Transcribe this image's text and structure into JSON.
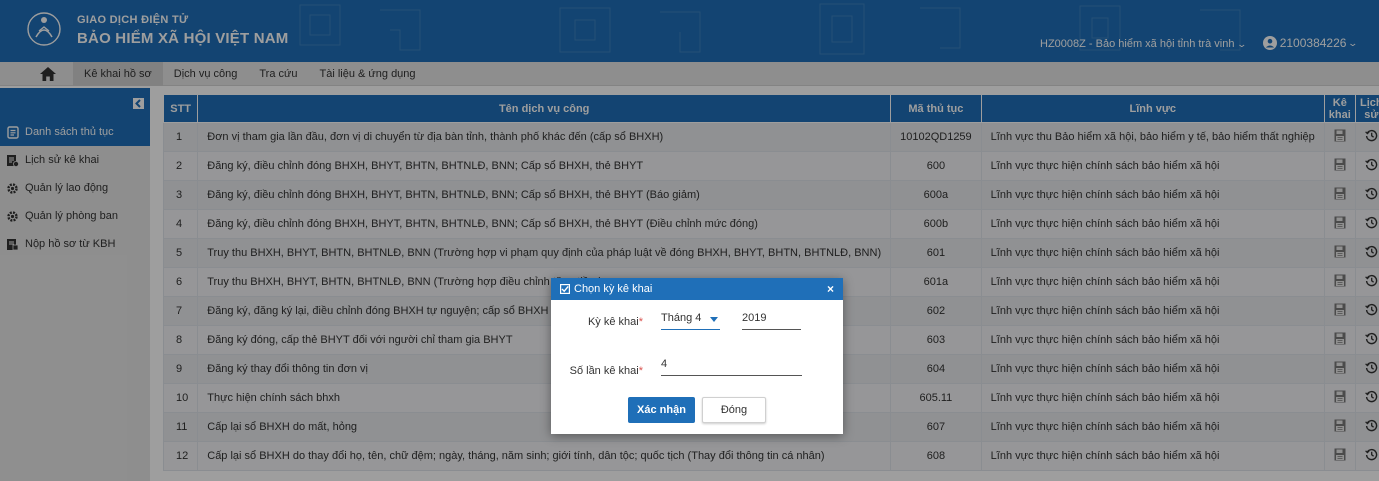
{
  "header": {
    "brand_sub": "GIAO DỊCH ĐIỆN TỬ",
    "brand_main": "BẢO HIỂM XÃ HỘI VIỆT NAM",
    "org": "HZ0008Z - Bảo hiểm xã hội tỉnh trà vinh",
    "user": "2100384226",
    "color": "#1f6fb8"
  },
  "nav": {
    "items": [
      "Kê khai hồ sơ",
      "Dịch vụ công",
      "Tra cứu",
      "Tài liệu & ứng dụng"
    ]
  },
  "sidebar": {
    "items": [
      {
        "label": "Danh sách thủ tục",
        "icon": "document-list-icon"
      },
      {
        "label": "Lịch sử kê khai",
        "icon": "history-doc-icon"
      },
      {
        "label": "Quản lý lao động",
        "icon": "gear-icon"
      },
      {
        "label": "Quản lý phòng ban",
        "icon": "gear-icon"
      },
      {
        "label": "Nộp hồ sơ từ KBH",
        "icon": "upload-doc-icon"
      }
    ]
  },
  "table": {
    "headers": [
      "STT",
      "Tên dịch vụ công",
      "Mã thủ tục",
      "Lĩnh vực",
      "Kê khai",
      "Lịch sử"
    ],
    "rows": [
      [
        "1",
        "Đơn vị tham gia lần đầu, đơn vị di chuyển từ địa bàn tỉnh, thành phố khác đến (cấp sổ BHXH)",
        "10102QD1259",
        "Lĩnh vực thu Bảo hiểm xã hội, bảo hiểm y tế, bảo hiểm thất nghiệp"
      ],
      [
        "2",
        "Đăng ký, điều chỉnh đóng BHXH, BHYT, BHTN, BHTNLĐ, BNN; Cấp sổ BHXH, thẻ BHYT",
        "600",
        "Lĩnh vực thực hiện chính sách bảo hiểm xã hội"
      ],
      [
        "3",
        "Đăng ký, điều chỉnh đóng BHXH, BHYT, BHTN, BHTNLĐ, BNN; Cấp sổ BHXH, thẻ BHYT (Báo giảm)",
        "600a",
        "Lĩnh vực thực hiện chính sách bảo hiểm xã hội"
      ],
      [
        "4",
        "Đăng ký, điều chỉnh đóng BHXH, BHYT, BHTN, BHTNLĐ, BNN; Cấp sổ BHXH, thẻ BHYT (Điều chỉnh mức đóng)",
        "600b",
        "Lĩnh vực thực hiện chính sách bảo hiểm xã hội"
      ],
      [
        "5",
        "Truy thu BHXH, BHYT, BHTN, BHTNLĐ, BNN (Trường hợp vi phạm quy định của pháp luật về đóng BHXH, BHYT, BHTN, BHTNLĐ, BNN)",
        "601",
        "Lĩnh vực thực hiện chính sách bảo hiểm xã hội"
      ],
      [
        "6",
        "Truy thu BHXH, BHYT, BHTN, BHTNLĐ, BNN (Trường hợp điều chỉnh tăng tiền lương",
        "601a",
        "Lĩnh vực thực hiện chính sách bảo hiểm xã hội"
      ],
      [
        "7",
        "Đăng ký, đăng ký lại, điều chỉnh đóng BHXH tự nguyện; cấp sổ BHXH",
        "602",
        "Lĩnh vực thực hiện chính sách bảo hiểm xã hội"
      ],
      [
        "8",
        "Đăng ký đóng, cấp thẻ BHYT đối với người chỉ tham gia BHYT",
        "603",
        "Lĩnh vực thực hiện chính sách bảo hiểm xã hội"
      ],
      [
        "9",
        "Đăng ký thay đổi thông tin đơn vị",
        "604",
        "Lĩnh vực thực hiện chính sách bảo hiểm xã hội"
      ],
      [
        "10",
        "Thực hiện chính sách bhxh",
        "605.11",
        "Lĩnh vực thực hiện chính sách bảo hiểm xã hội"
      ],
      [
        "11",
        "Cấp lại sổ BHXH do mất, hỏng",
        "607",
        "Lĩnh vực thực hiện chính sách bảo hiểm xã hội"
      ],
      [
        "12",
        "Cấp lại sổ BHXH do thay đổi họ, tên, chữ đệm; ngày, tháng, năm sinh; giới tính, dân tộc; quốc tịch (Thay đổi thông tin cá nhân)",
        "608",
        "Lĩnh vực thực hiện chính sách bảo hiểm xã hội"
      ]
    ]
  },
  "modal": {
    "title": "Chọn kỳ kê khai",
    "period_label": "Kỳ kê khai",
    "month_value": "Tháng 4",
    "year_value": "2019",
    "count_label": "Số lần kê khai",
    "count_value": "4",
    "required_mark": "*",
    "close_glyph": "×",
    "confirm_label": "Xác nhận",
    "cancel_label": "Đóng"
  }
}
